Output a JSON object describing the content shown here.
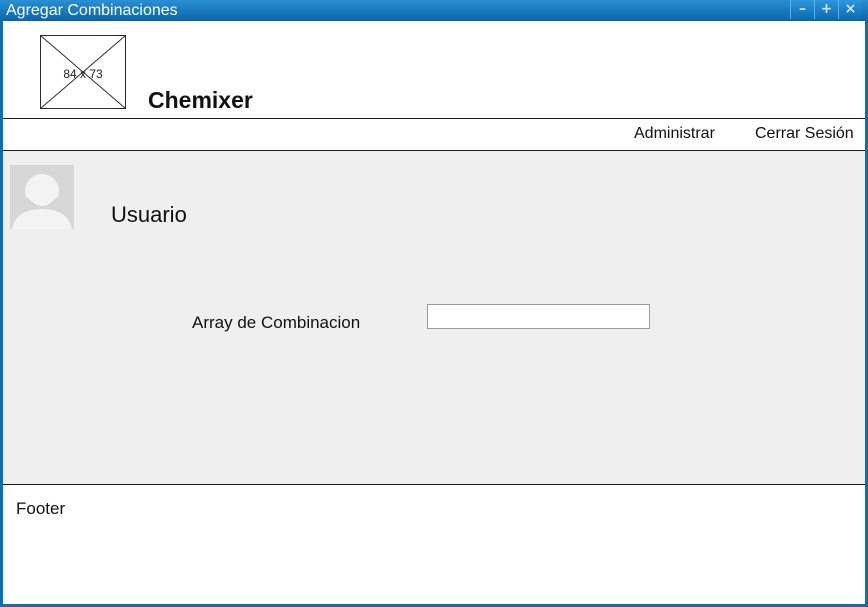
{
  "window": {
    "title": "Agregar Combinaciones",
    "controls": {
      "minimize": "–",
      "maximize": "+",
      "close": "×"
    }
  },
  "header": {
    "logo_placeholder": "84 x 73",
    "app_name": "Chemixer"
  },
  "nav": {
    "items": [
      {
        "label": "Administrar"
      },
      {
        "label": "Cerrar Sesión"
      }
    ]
  },
  "main": {
    "user_label": "Usuario",
    "form": {
      "label": "Array de Combinacion",
      "value": ""
    }
  },
  "footer": {
    "text": "Footer"
  },
  "colors": {
    "titlebar": "#0b66a9",
    "main_background": "#efefef",
    "avatar_background": "#d9d9d9"
  },
  "icons": {
    "avatar": "user-placeholder-icon",
    "logo": "image-placeholder-icon"
  }
}
